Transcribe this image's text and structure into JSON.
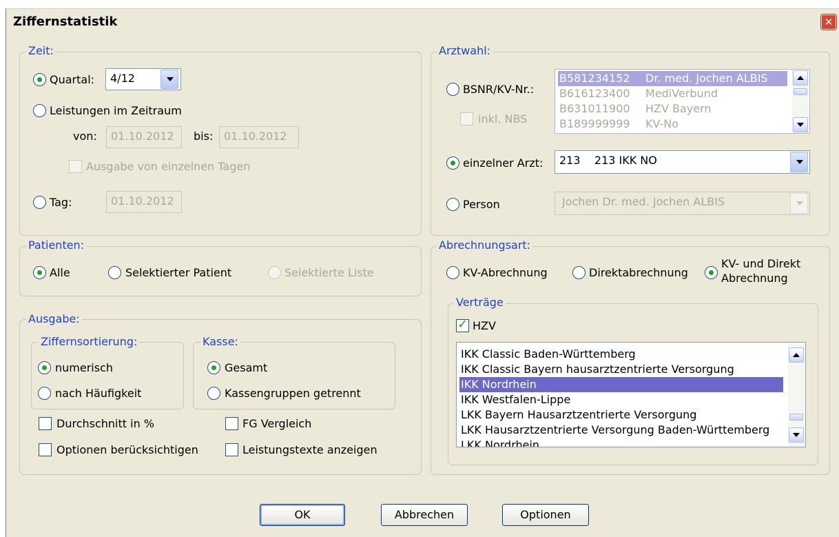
{
  "window": {
    "title": "Ziffernstatistik"
  },
  "zeit": {
    "group_title": "Zeit:",
    "quartal_label": "Quartal:",
    "quartal_value": "4/12",
    "leistungen_label": "Leistungen im Zeitraum",
    "von_label": "von:",
    "von_value": "01.10.2012",
    "bis_label": "bis:",
    "bis_value": "01.10.2012",
    "ausgabe_tage_label": "Ausgabe von einzelnen Tagen",
    "tag_label": "Tag:",
    "tag_value": "01.10.2012"
  },
  "arztwahl": {
    "group_title": "Arztwahl:",
    "bsnr_label": "BSNR/KV-Nr.:",
    "inkl_nbs_label": "inkl. NBS",
    "bsnr_list": [
      {
        "nr": "B581234152",
        "name": "Dr. med. Jochen ALBIS"
      },
      {
        "nr": "B616123400",
        "name": "MediVerbund"
      },
      {
        "nr": "B631011900",
        "name": "HZV Bayern"
      },
      {
        "nr": "B189999999",
        "name": "KV-No"
      }
    ],
    "einzelner_label": "einzelner Arzt:",
    "einzelner_value": "213    213 IKK NO",
    "person_label": "Person",
    "person_value": "Jochen Dr. med. Jochen ALBIS"
  },
  "patienten": {
    "group_title": "Patienten:",
    "alle_label": "Alle",
    "selektierter_label": "Selektierter Patient",
    "liste_label": "Selektierte Liste"
  },
  "abrechnungsart": {
    "group_title": "Abrechnungsart:",
    "kv_label": "KV-Abrechnung",
    "direkt_label": "Direktabrechnung",
    "kv_direkt_label_1": "KV- und Direkt",
    "kv_direkt_label_2": "Abrechnung"
  },
  "vertraege": {
    "group_title": "Verträge",
    "hzv_label": "HZV",
    "items": [
      "IKK Classic Baden-Württemberg",
      "IKK Classic Bayern hausarztzentrierte Versorgung",
      "IKK Nordrhein",
      "IKK Westfalen-Lippe",
      "LKK Bayern Hausarztzentrierte Versorgung",
      "LKK Hausarztzentrierte Versorgung Baden-Württemberg",
      "LKK Nordrhein"
    ]
  },
  "ausgabe": {
    "group_title": "Ausgabe:",
    "sort_title": "Ziffernsortierung:",
    "numerisch_label": "numerisch",
    "haeufigkeit_label": "nach Häufigkeit",
    "kasse_title": "Kasse:",
    "gesamt_label": "Gesamt",
    "kassengruppen_label": "Kassengruppen getrennt",
    "durchschnitt_label": "Durchschnitt in %",
    "fg_label": "FG Vergleich",
    "optionen_label": "Optionen berücksichtigen",
    "leistungstexte_label": "Leistungstexte anzeigen"
  },
  "buttons": {
    "ok": "OK",
    "abbrechen": "Abbrechen",
    "optionen": "Optionen"
  },
  "colors": {
    "group_title": "#1e44c8",
    "selection": "#6c67c8",
    "radio_dot": "#21a121"
  }
}
